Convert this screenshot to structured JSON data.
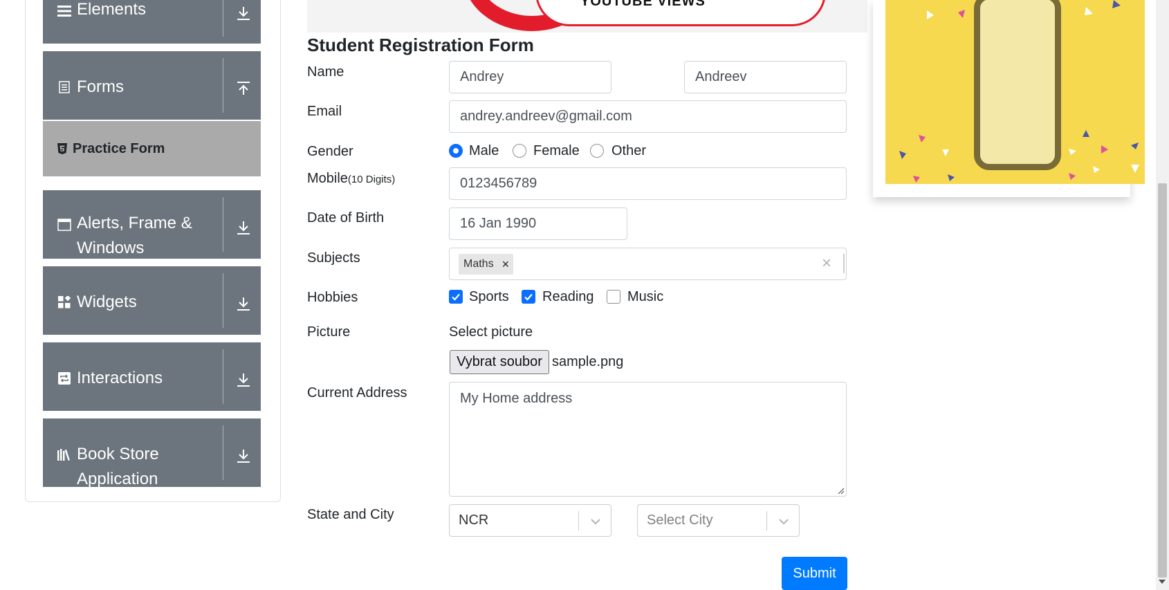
{
  "sidebar": {
    "groups": [
      {
        "label": "Elements",
        "icon": "list-icon",
        "arrow": "download-arrow-icon"
      },
      {
        "label": "Forms",
        "icon": "document-icon",
        "arrow": "upload-arrow-icon"
      },
      {
        "label": "Alerts, Frame & Windows",
        "icon": "window-icon",
        "arrow": "download-arrow-icon"
      },
      {
        "label": "Widgets",
        "icon": "widgets-icon",
        "arrow": "download-arrow-icon"
      },
      {
        "label": "Interactions",
        "icon": "interactions-icon",
        "arrow": "download-arrow-icon"
      },
      {
        "label": "Book Store Application",
        "icon": "books-icon",
        "arrow": "download-arrow-icon"
      }
    ],
    "active_item": {
      "label": "Practice Form",
      "icon": "html5-icon"
    }
  },
  "banner": {
    "text": "YOUTUBE VIEWS"
  },
  "form": {
    "title": "Student Registration Form",
    "name": {
      "label": "Name",
      "first_name": "Andrey",
      "last_name": "Andreev"
    },
    "email": {
      "label": "Email",
      "value": "andrey.andreev@gmail.com"
    },
    "gender": {
      "label": "Gender",
      "options": [
        "Male",
        "Female",
        "Other"
      ],
      "selected": "Male"
    },
    "mobile": {
      "label": "Mobile",
      "hint": "(10 Digits)",
      "value": "0123456789"
    },
    "dob": {
      "label": "Date of Birth",
      "value": "16 Jan 1990"
    },
    "subjects": {
      "label": "Subjects",
      "chips": [
        "Maths"
      ],
      "chip_remove": "×",
      "clear": "×"
    },
    "hobbies": {
      "label": "Hobbies",
      "options": [
        "Sports",
        "Reading",
        "Music"
      ],
      "checked": [
        "Sports",
        "Reading"
      ]
    },
    "picture": {
      "label": "Picture",
      "prompt": "Select picture",
      "button": "Vybrat soubor",
      "file_name": "sample.png"
    },
    "address": {
      "label": "Current Address",
      "value": "My Home address"
    },
    "state_city": {
      "label": "State and City",
      "state": "NCR",
      "city_placeholder": "Select City"
    },
    "submit": "Submit"
  },
  "colors": {
    "sidebar_bg": "#6c757d",
    "active_bg": "#aaaaaa",
    "primary": "#007bff",
    "ad_bg": "#f6d94f",
    "banner_red": "#e31c2c"
  }
}
